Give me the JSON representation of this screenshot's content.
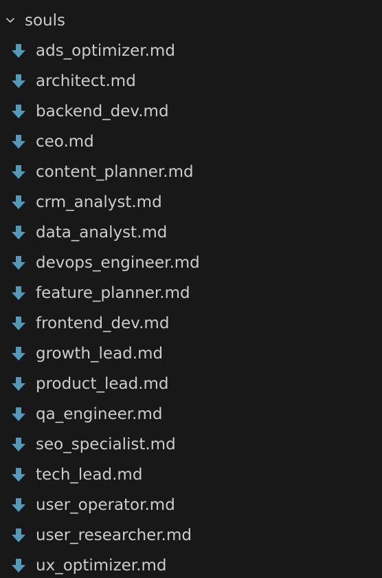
{
  "explorer": {
    "folder": {
      "name": "souls",
      "expanded": true,
      "icon": "chevron-down-icon"
    },
    "icon_color": "#519aba",
    "files": [
      {
        "name": "ads_optimizer.md",
        "icon": "markdown-arrow-down-icon"
      },
      {
        "name": "architect.md",
        "icon": "markdown-arrow-down-icon"
      },
      {
        "name": "backend_dev.md",
        "icon": "markdown-arrow-down-icon"
      },
      {
        "name": "ceo.md",
        "icon": "markdown-arrow-down-icon"
      },
      {
        "name": "content_planner.md",
        "icon": "markdown-arrow-down-icon"
      },
      {
        "name": "crm_analyst.md",
        "icon": "markdown-arrow-down-icon"
      },
      {
        "name": "data_analyst.md",
        "icon": "markdown-arrow-down-icon"
      },
      {
        "name": "devops_engineer.md",
        "icon": "markdown-arrow-down-icon"
      },
      {
        "name": "feature_planner.md",
        "icon": "markdown-arrow-down-icon"
      },
      {
        "name": "frontend_dev.md",
        "icon": "markdown-arrow-down-icon"
      },
      {
        "name": "growth_lead.md",
        "icon": "markdown-arrow-down-icon"
      },
      {
        "name": "product_lead.md",
        "icon": "markdown-arrow-down-icon"
      },
      {
        "name": "qa_engineer.md",
        "icon": "markdown-arrow-down-icon"
      },
      {
        "name": "seo_specialist.md",
        "icon": "markdown-arrow-down-icon"
      },
      {
        "name": "tech_lead.md",
        "icon": "markdown-arrow-down-icon"
      },
      {
        "name": "user_operator.md",
        "icon": "markdown-arrow-down-icon"
      },
      {
        "name": "user_researcher.md",
        "icon": "markdown-arrow-down-icon"
      },
      {
        "name": "ux_optimizer.md",
        "icon": "markdown-arrow-down-icon"
      }
    ]
  }
}
